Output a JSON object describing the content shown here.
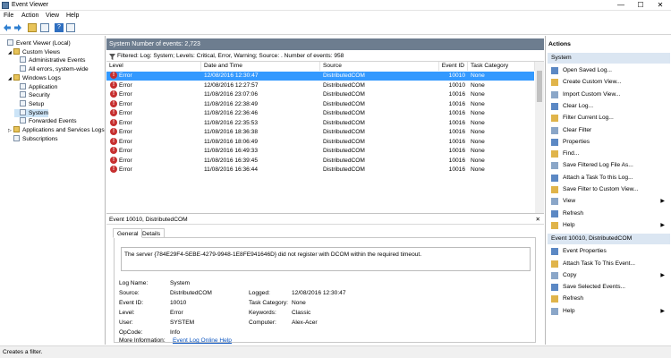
{
  "window": {
    "title": "Event Viewer",
    "minimize": "—",
    "maximize": "☐",
    "close": "✕"
  },
  "menu": [
    "File",
    "Action",
    "View",
    "Help"
  ],
  "tree": [
    {
      "label": "Event Viewer (Local)",
      "indent": 0,
      "icon": "computer-icon",
      "expander": ""
    },
    {
      "label": "Custom Views",
      "indent": 1,
      "icon": "folder-icon",
      "expander": "◢"
    },
    {
      "label": "Administrative Events",
      "indent": 2,
      "icon": "filter-icon",
      "expander": ""
    },
    {
      "label": "All errors, system-wide",
      "indent": 2,
      "icon": "filter-icon",
      "expander": ""
    },
    {
      "label": "Windows Logs",
      "indent": 1,
      "icon": "folder-icon",
      "expander": "◢"
    },
    {
      "label": "Application",
      "indent": 2,
      "icon": "log-icon",
      "expander": ""
    },
    {
      "label": "Security",
      "indent": 2,
      "icon": "log-icon",
      "expander": ""
    },
    {
      "label": "Setup",
      "indent": 2,
      "icon": "log-icon",
      "expander": ""
    },
    {
      "label": "System",
      "indent": 2,
      "icon": "log-icon",
      "expander": "",
      "selected": true
    },
    {
      "label": "Forwarded Events",
      "indent": 2,
      "icon": "log-icon",
      "expander": ""
    },
    {
      "label": "Applications and Services Logs",
      "indent": 1,
      "icon": "folder-icon",
      "expander": "▷"
    },
    {
      "label": "Subscriptions",
      "indent": 1,
      "icon": "subscription-icon",
      "expander": ""
    }
  ],
  "center": {
    "header": "System    Number of events: 2,723",
    "filter": "Filtered: Log: System; Levels: Critical, Error, Warning; Source: . Number of events: 958",
    "columns": [
      "Level",
      "Date and Time",
      "Source",
      "Event ID",
      "Task Category"
    ],
    "rows": [
      {
        "level": "Error",
        "date": "12/08/2016 12:30:47",
        "source": "DistributedCOM",
        "id": "10010",
        "task": "None",
        "selected": true
      },
      {
        "level": "Error",
        "date": "12/08/2016 12:27:57",
        "source": "DistributedCOM",
        "id": "10010",
        "task": "None"
      },
      {
        "level": "Error",
        "date": "11/08/2016 23:07:06",
        "source": "DistributedCOM",
        "id": "10016",
        "task": "None"
      },
      {
        "level": "Error",
        "date": "11/08/2016 22:38:49",
        "source": "DistributedCOM",
        "id": "10016",
        "task": "None"
      },
      {
        "level": "Error",
        "date": "11/08/2016 22:36:46",
        "source": "DistributedCOM",
        "id": "10016",
        "task": "None"
      },
      {
        "level": "Error",
        "date": "11/08/2016 22:35:53",
        "source": "DistributedCOM",
        "id": "10016",
        "task": "None"
      },
      {
        "level": "Error",
        "date": "11/08/2016 18:36:38",
        "source": "DistributedCOM",
        "id": "10016",
        "task": "None"
      },
      {
        "level": "Error",
        "date": "11/08/2016 18:06:49",
        "source": "DistributedCOM",
        "id": "10016",
        "task": "None"
      },
      {
        "level": "Error",
        "date": "11/08/2016 16:49:33",
        "source": "DistributedCOM",
        "id": "10016",
        "task": "None"
      },
      {
        "level": "Error",
        "date": "11/08/2016 16:39:45",
        "source": "DistributedCOM",
        "id": "10016",
        "task": "None"
      },
      {
        "level": "Error",
        "date": "11/08/2016 16:36:44",
        "source": "DistributedCOM",
        "id": "10016",
        "task": "None"
      }
    ]
  },
  "detail": {
    "header": "Event 10010, DistributedCOM",
    "tabs": [
      "General",
      "Details"
    ],
    "description": "The server {784E29F4-5EBE-4279-9948-1E8FE941646D} did not register with DCOM within the required timeout.",
    "log_name_label": "Log Name:",
    "log_name": "System",
    "source_label": "Source:",
    "source": "DistributedCOM",
    "logged_label": "Logged:",
    "logged": "12/08/2016 12:30:47",
    "event_id_label": "Event ID:",
    "event_id": "10010",
    "task_label": "Task Category:",
    "task": "None",
    "level_label": "Level:",
    "level": "Error",
    "keywords_label": "Keywords:",
    "keywords": "Classic",
    "user_label": "User:",
    "user": "SYSTEM",
    "computer_label": "Computer:",
    "computer": "Alex-Acer",
    "opcode_label": "OpCode:",
    "opcode": "Info",
    "more_label": "More Information:",
    "more_link": "Event Log Online Help"
  },
  "actions": {
    "title": "Actions",
    "section1": "System",
    "items1": [
      {
        "label": "Open Saved Log...",
        "icon": "open-log-icon"
      },
      {
        "label": "Create Custom View...",
        "icon": "create-view-icon"
      },
      {
        "label": "Import Custom View...",
        "icon": "import-view-icon"
      },
      {
        "label": "Clear Log...",
        "icon": "clear-log-icon"
      },
      {
        "label": "Filter Current Log...",
        "icon": "filter-icon"
      },
      {
        "label": "Clear Filter",
        "icon": "clear-filter-icon"
      },
      {
        "label": "Properties",
        "icon": "properties-icon"
      },
      {
        "label": "Find...",
        "icon": "find-icon"
      },
      {
        "label": "Save Filtered Log File As...",
        "icon": "save-icon"
      },
      {
        "label": "Attach a Task To this Log...",
        "icon": "attach-task-icon"
      },
      {
        "label": "Save Filter to Custom View...",
        "icon": "save-filter-icon"
      },
      {
        "label": "View",
        "icon": "view-icon",
        "submenu": true
      },
      {
        "label": "Refresh",
        "icon": "refresh-icon"
      },
      {
        "label": "Help",
        "icon": "help-icon",
        "submenu": true
      }
    ],
    "section2": "Event 10010, DistributedCOM",
    "items2": [
      {
        "label": "Event Properties",
        "icon": "event-properties-icon"
      },
      {
        "label": "Attach Task To This Event...",
        "icon": "attach-task-icon"
      },
      {
        "label": "Copy",
        "icon": "copy-icon",
        "submenu": true
      },
      {
        "label": "Save Selected Events...",
        "icon": "save-icon"
      },
      {
        "label": "Refresh",
        "icon": "refresh-icon"
      },
      {
        "label": "Help",
        "icon": "help-icon",
        "submenu": true
      }
    ]
  },
  "status": "Creates a filter.",
  "colors": {
    "header_bar": "#6d7d8f",
    "selection": "#cce4f7",
    "section": "#dbe6f2",
    "error": "#c62f2f"
  }
}
